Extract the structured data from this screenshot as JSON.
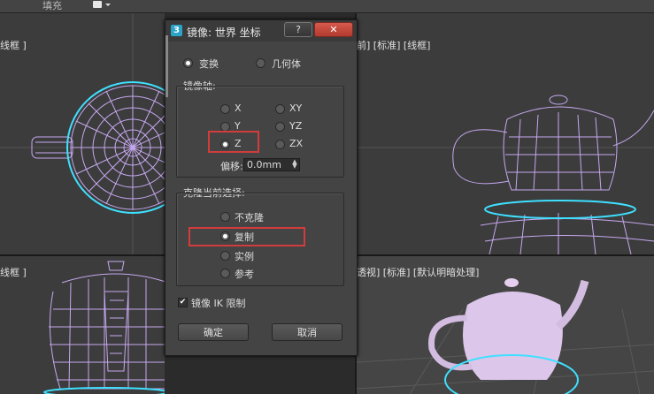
{
  "toolbar": {
    "fill_label": "填充"
  },
  "viewports": {
    "top_left": {
      "label": "线框 ]"
    },
    "top_right": {
      "label": "前] [标准] [线框]"
    },
    "bottom_left": {
      "label": "线框 ]"
    },
    "bottom_right": {
      "label": "透视] [标准] [默认明暗处理]"
    }
  },
  "dialog": {
    "title": "镜像: 世界 坐标",
    "help_label": "?",
    "close_label": "✕",
    "mode": {
      "transform_label": "变换",
      "geometry_label": "几何体",
      "selected": "transform"
    },
    "mirror_axis": {
      "group_label": "镜像轴:",
      "axes": {
        "x": "X",
        "y": "Y",
        "z": "Z",
        "xy": "XY",
        "yz": "YZ",
        "zx": "ZX"
      },
      "selected": "Z",
      "offset_label": "偏移:",
      "offset_value": "0.0mm"
    },
    "clone": {
      "group_label": "克隆当前选择:",
      "options": {
        "no_clone": "不克隆",
        "copy": "复制",
        "instance": "实例",
        "reference": "参考"
      },
      "selected": "复制"
    },
    "mirror_ik": {
      "label": "镜像 IK 限制",
      "checked": true,
      "check_glyph": "✔"
    },
    "ok_label": "确定",
    "cancel_label": "取消"
  },
  "colors": {
    "highlight_box": "#d23c3c",
    "teapot_wire": "#c6a8f0",
    "selection": "#3fe0ff"
  }
}
